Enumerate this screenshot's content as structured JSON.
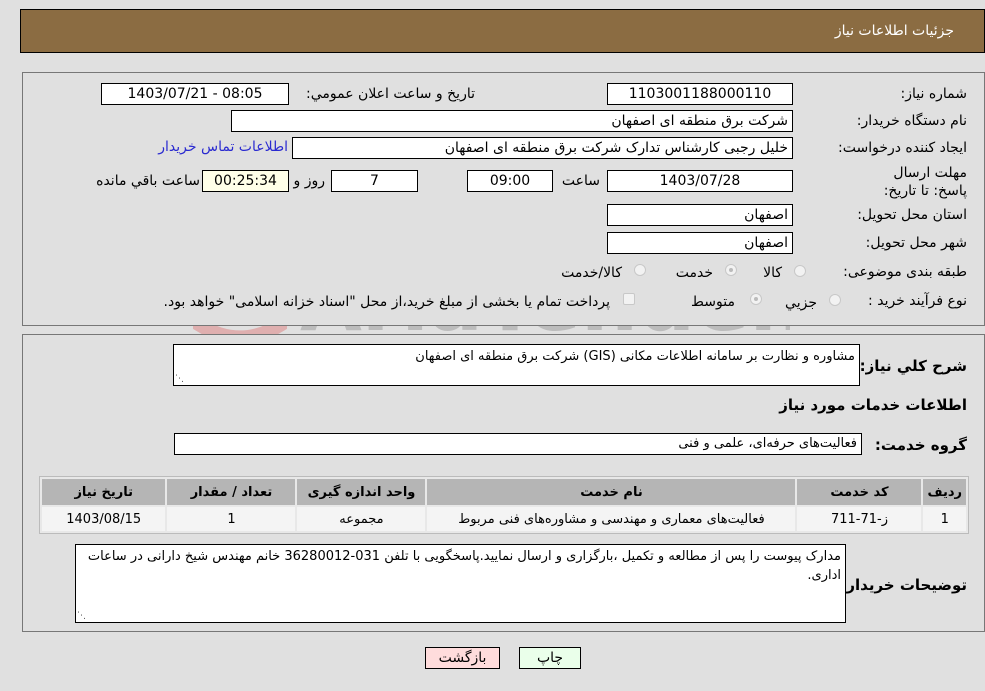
{
  "header": {
    "title": "جزئیات اطلاعات نیاز"
  },
  "details": {
    "need_number_label": "شماره نیاز:",
    "need_number": "1103001188000110",
    "announce_label": "تاريخ و ساعت اعلان عمومي:",
    "announce_value": "1403/07/21 - 08:05",
    "buyer_org_label": "نام دستگاه خریدار:",
    "buyer_org": "شرکت برق منطقه ای اصفهان",
    "creator_label": "ایجاد کننده درخواست:",
    "creator": "خلیل رجبی کارشناس تدارک شرکت برق منطقه ای اصفهان",
    "contact_link": "اطلاعات تماس خریدار",
    "deadline_label": "مهلت ارسال پاسخ: تا تاریخ:",
    "deadline_date": "1403/07/28",
    "time_label": "ساعت",
    "deadline_time": "09:00",
    "days_value": "7",
    "days_label": "روز و",
    "remaining_time": "00:25:34",
    "remaining_label": "ساعت باقي مانده",
    "province_label": "استان محل تحویل:",
    "province": "اصفهان",
    "city_label": "شهر محل تحویل:",
    "city": "اصفهان",
    "category_label": "طبقه بندی موضوعی:",
    "category_options": [
      {
        "label": "کالا",
        "checked": false
      },
      {
        "label": "خدمت",
        "checked": true
      },
      {
        "label": "کالا/خدمت",
        "checked": false
      }
    ],
    "process_label": "نوع فرآیند خرید :",
    "process_options": [
      {
        "label": "جزيي",
        "checked": false
      },
      {
        "label": "متوسط",
        "checked": true
      }
    ],
    "treasury_note": "پرداخت تمام یا بخشی از مبلغ خرید،از محل \"اسناد خزانه اسلامی\" خواهد بود."
  },
  "summary": {
    "description_label": "شرح کلي نياز:",
    "description": "مشاوره و نظارت بر سامانه اطلاعات مکانی (GIS) شرکت برق منطقه ای اصفهان",
    "services_heading": "اطلاعات خدمات مورد نیاز",
    "service_group_label": "گروه خدمت:",
    "service_group": "فعالیت‌های حرفه‌ای، علمی و فنی"
  },
  "table": {
    "headers": [
      "ردیف",
      "کد خدمت",
      "نام خدمت",
      "واحد اندازه گیری",
      "تعداد / مقدار",
      "تاریخ نیاز"
    ],
    "rows": [
      [
        "1",
        "ز-71-711",
        "فعالیت‌های معماری و مهندسی و مشاوره‌های فنی مربوط",
        "مجموعه",
        "1",
        "1403/08/15"
      ]
    ]
  },
  "buyer_notes": {
    "label": "توضیحات خریدار:",
    "text": "مدارک پیوست را پس از مطالعه و تکمیل ،بارگزاری و ارسال نمایید.پاسخگویی با تلفن 031-36280012 خانم مهندس شیخ دارانی در ساعات اداری."
  },
  "buttons": {
    "print": "چاپ",
    "back": "بازگشت"
  },
  "watermark": {
    "text": "AriaTender.neT"
  }
}
